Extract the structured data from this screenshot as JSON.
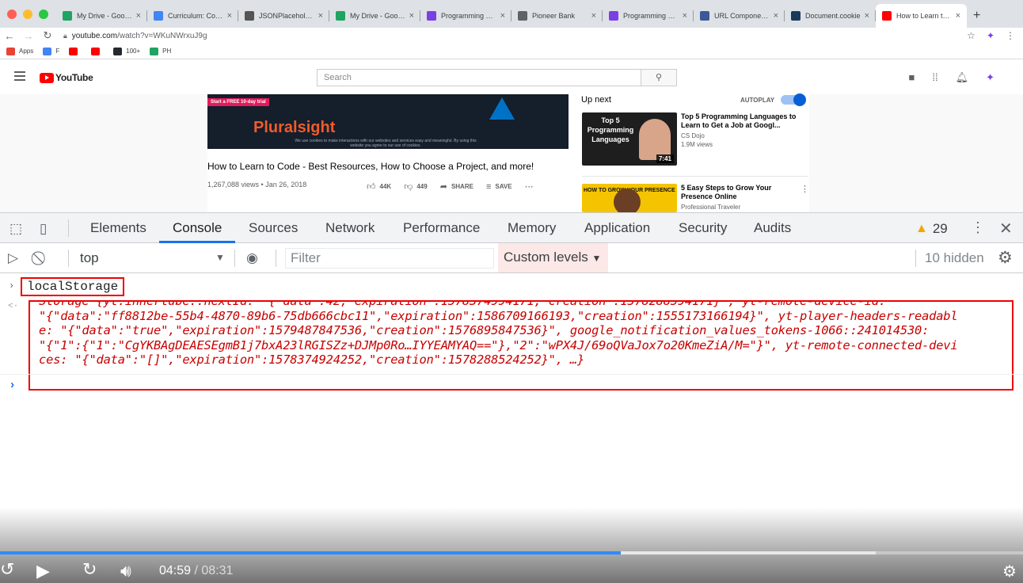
{
  "browser": {
    "tabs": [
      {
        "title": "My Drive - Google",
        "favicon": "drive-icon",
        "color": "#1fa463"
      },
      {
        "title": "Curriculum: Comp",
        "favicon": "docs-icon",
        "color": "#4285f4"
      },
      {
        "title": "JSONPlaceholder",
        "favicon": "code-icon",
        "color": "#555555"
      },
      {
        "title": "My Drive - Google",
        "favicon": "drive-icon",
        "color": "#1fa463"
      },
      {
        "title": "Programming Hero",
        "favicon": "hero-icon",
        "color": "#7b3fe4"
      },
      {
        "title": "Pioneer Bank",
        "favicon": "globe-icon",
        "color": "#5f6368"
      },
      {
        "title": "Programming Hero",
        "favicon": "hero-icon",
        "color": "#7b3fe4"
      },
      {
        "title": "URL Components",
        "favicon": "mdn-icon",
        "color": "#3b5998"
      },
      {
        "title": "Document.cookie",
        "favicon": "mdn-icon",
        "color": "#1a3a5c"
      },
      {
        "title": "How to Learn to C",
        "favicon": "youtube-icon",
        "color": "#ff0000",
        "active": true
      }
    ],
    "url_host": "youtube.com",
    "url_path": "/watch?v=WKuNWrxuJ9g",
    "bookmarks": [
      {
        "label": "Apps",
        "color": "#ea4335"
      },
      {
        "label": "F",
        "color": "#4285f4"
      },
      {
        "label": "",
        "color": "#ff0000"
      },
      {
        "label": "",
        "color": "#ff0000"
      },
      {
        "label": "100+",
        "color": "#24292e"
      },
      {
        "label": "PH",
        "color": "#1fa463"
      }
    ]
  },
  "youtube": {
    "logo_text": "YouTube",
    "search_placeholder": "Search",
    "ad": {
      "trial": "Start a FREE 10-day trial",
      "brand": "Pluralsight",
      "notice": "We use cookies to make interactions with our websites and services easy and meaningful. By using this website you agree to our use of cookies."
    },
    "video_title": "How to Learn to Code - Best Resources, How to Choose a Project, and more!",
    "views": "1,267,088 views",
    "date": "Jan 26, 2018",
    "likes": "44K",
    "dislikes": "449",
    "share": "SHARE",
    "save": "SAVE",
    "up_next": "Up next",
    "autoplay": "AUTOPLAY",
    "cards": [
      {
        "title": "Top 5 Programming Languages to Learn to Get a Job at Googl...",
        "channel": "CS Dojo",
        "views": "1.9M views",
        "duration": "7:41",
        "thumb_text": "Top 5 Programming Languages"
      },
      {
        "title": "5 Easy Steps to Grow Your Presence Online",
        "channel": "Professional Traveler",
        "views": "",
        "duration": "",
        "thumb_text": "HOW TO GROW YOUR PRESENCE"
      }
    ]
  },
  "devtools": {
    "tabs": [
      "Elements",
      "Console",
      "Sources",
      "Network",
      "Performance",
      "Memory",
      "Application",
      "Security",
      "Audits"
    ],
    "active_tab": "Console",
    "warnings": "29",
    "context": "top",
    "filter_placeholder": "Filter",
    "levels": "Custom levels",
    "hidden": "10 hidden",
    "command": "localStorage",
    "output": {
      "line1_a": "Storage {yt.innertube::nextId: \"{\"data\":42,\"expiration\":1578374994171,\"creation\":1578288594171}\", yt-remote-device-id:",
      "line2": "\"{\"data\":\"ff8812be-55b4-4870-89b6-75db666cbc11\",\"expiration\":1586709166193,\"creation\":1555173166194}\", yt-player-headers-readabl",
      "line3": "e: \"{\"data\":\"true\",\"expiration\":1579487847536,\"creation\":1576895847536}\", google_notification_values_tokens-1066::241014530:",
      "line4": "\"{\"1\":{\"1\":\"CgYKBAgDEAESEgmB1j7bxA23lRGISZz+DJMp0Ro…IYYEAMYAQ==\"},\"2\":\"wPX4J/69oQVaJox7o20KmeZiA/M=\"}\", yt-remote-connected-devi",
      "line5": "ces: \"{\"data\":\"[]\",\"expiration\":1578374924252,\"creation\":1578288524252}\", …}"
    }
  },
  "player": {
    "current_time": "04:59",
    "separator": "/",
    "duration": "08:31",
    "played_fraction": 0.607,
    "buffered_fraction": 0.856
  }
}
